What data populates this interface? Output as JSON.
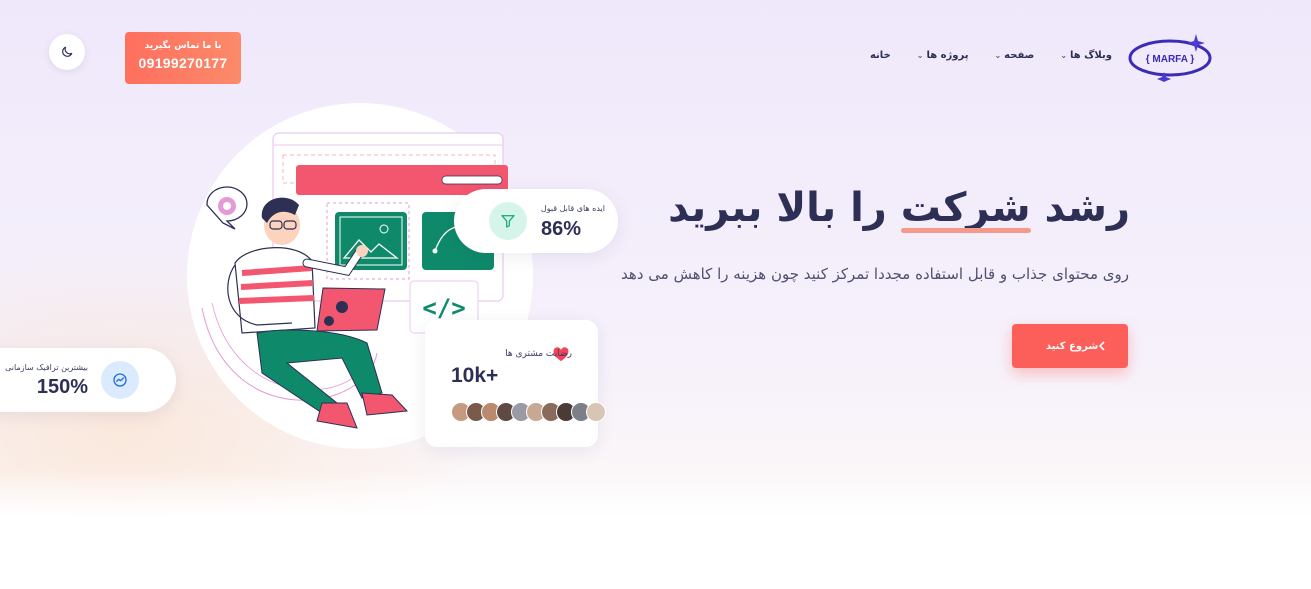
{
  "header": {
    "logo_text": "{ MARFA }",
    "nav": [
      {
        "label": "خانه",
        "has_dropdown": false
      },
      {
        "label": "پروژه ها",
        "has_dropdown": true
      },
      {
        "label": "صفحه",
        "has_dropdown": true
      },
      {
        "label": "وبلاگ ها",
        "has_dropdown": true
      }
    ],
    "contact": {
      "label": "با ما تماس بگیرید",
      "phone": "09199270177"
    },
    "theme_toggle_icon": "moon-icon"
  },
  "hero": {
    "title_pre": "رشد ",
    "title_highlight": "شرکت",
    "title_post": " را بالا ببرید",
    "subtitle": "روی محتوای جذاب و قابل استفاده مجددا تمرکز کنید چون هزینه را کاهش می دهد",
    "cta_label": "شروع کنید"
  },
  "stats": {
    "ideas": {
      "label": "ایده های قابل قبول",
      "value": "86%",
      "icon": "filter-icon"
    },
    "satisfaction": {
      "label": "رضایت مشتری ها",
      "value": "10k+",
      "icon": "heart-icon"
    },
    "traffic": {
      "label": "بیشترین ترافیک سازمانی",
      "value": "150%",
      "icon": "trend-icon"
    }
  },
  "colors": {
    "accent": "#fc5f5a",
    "brand": "#3b2bb5",
    "text": "#2d2f55",
    "green": "#0e8a6a",
    "pink": "#f3566f"
  }
}
